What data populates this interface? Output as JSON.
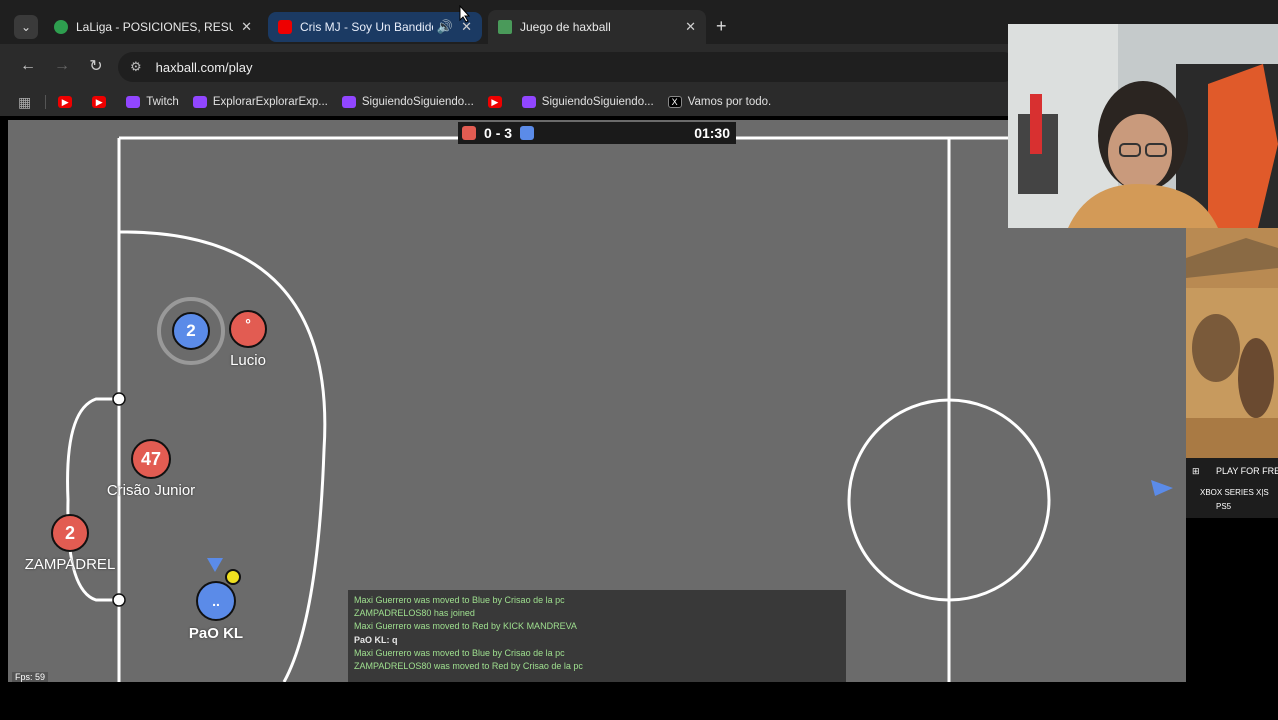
{
  "browser": {
    "tabs": [
      {
        "title": "LaLiga - POSICIONES, RESULTADOS",
        "favicon": "laliga-icon",
        "active": false
      },
      {
        "title": "Cris MJ - Soy Un Bandido (Video",
        "favicon": "youtube-icon",
        "active": false,
        "playing_audio": true
      },
      {
        "title": "Juego de haxball",
        "favicon": "haxball-icon",
        "active": true
      }
    ],
    "url": "haxball.com/play",
    "bookmarks": [
      {
        "label": "",
        "icon": "youtube-icon"
      },
      {
        "label": "",
        "icon": "youtube-icon"
      },
      {
        "label": "Twitch",
        "icon": "twitch-icon"
      },
      {
        "label": "ExplorarExplorarExp...",
        "icon": "twitch-icon"
      },
      {
        "label": "SiguiendoSiguiendo...",
        "icon": "twitch-icon"
      },
      {
        "label": "",
        "icon": "youtube-icon"
      },
      {
        "label": "SiguiendoSiguiendo...",
        "icon": "twitch-icon"
      },
      {
        "label": "Vamos por todo.",
        "icon": "x-icon"
      }
    ]
  },
  "game": {
    "score": {
      "red": "0",
      "separator": "-",
      "blue": "3"
    },
    "time": "01:30",
    "colors": {
      "red": "#e25c52",
      "blue": "#5b8be8",
      "pitch": "#6b6b6b",
      "ball": "#f0e020"
    },
    "players": [
      {
        "name": "",
        "number": "2",
        "team": "blue"
      },
      {
        "name": "Lucio",
        "number": "°",
        "team": "red"
      },
      {
        "name": "Crisão Junior",
        "number": "47",
        "team": "red"
      },
      {
        "name": "ZAMPADREL",
        "number": "2",
        "team": "red"
      },
      {
        "name": "PaO KL",
        "number": "..",
        "team": "blue"
      }
    ],
    "chat": [
      {
        "text": "Maxi Guerrero was moved to Blue by Crisao de la pc",
        "kind": "notice"
      },
      {
        "text": "ZAMPADRELOS80 has joined",
        "kind": "notice"
      },
      {
        "text": "Maxi Guerrero was moved to Red by KICK MANDREVA",
        "kind": "notice"
      },
      {
        "text": "PaO KL: q",
        "kind": "message"
      },
      {
        "text": "Maxi Guerrero was moved to Blue by Crisao de la pc",
        "kind": "notice"
      },
      {
        "text": "ZAMPADRELOS80 was moved to Red by Crisao de la pc",
        "kind": "notice"
      }
    ],
    "fps": "Fps: 59"
  },
  "ad": {
    "cta": "PLAY FOR FREE",
    "platforms": "XBOX SERIES X|S",
    "platform2": "PS5"
  }
}
